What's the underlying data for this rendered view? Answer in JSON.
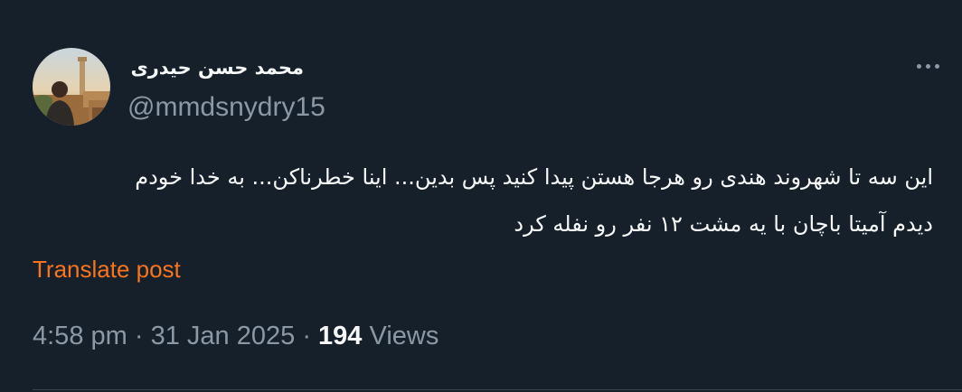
{
  "author": {
    "display_name": "محمد حسن حیدری",
    "handle": "@mmdsnydry15",
    "avatar": "profile-photo"
  },
  "tweet": {
    "lines": [
      "این سه تا شهروند هندی رو هرجا هستن پیدا کنید پس بدین... اینا خطرناکن... به خدا خودم",
      "دیدم آمیتا باچان با یه مشت ۱۲ نفر رو نفله کرد"
    ],
    "translate_label": "Translate post",
    "time": "4:58 pm",
    "date": "31 Jan 2025",
    "separator": "·",
    "views_count": "194",
    "views_label": "Views"
  },
  "icons": {
    "more": "more-horizontal-icon"
  },
  "colors": {
    "background": "#15202b",
    "text": "#f7f9f9",
    "secondary": "#8b98a5",
    "accent": "#f9741f"
  }
}
